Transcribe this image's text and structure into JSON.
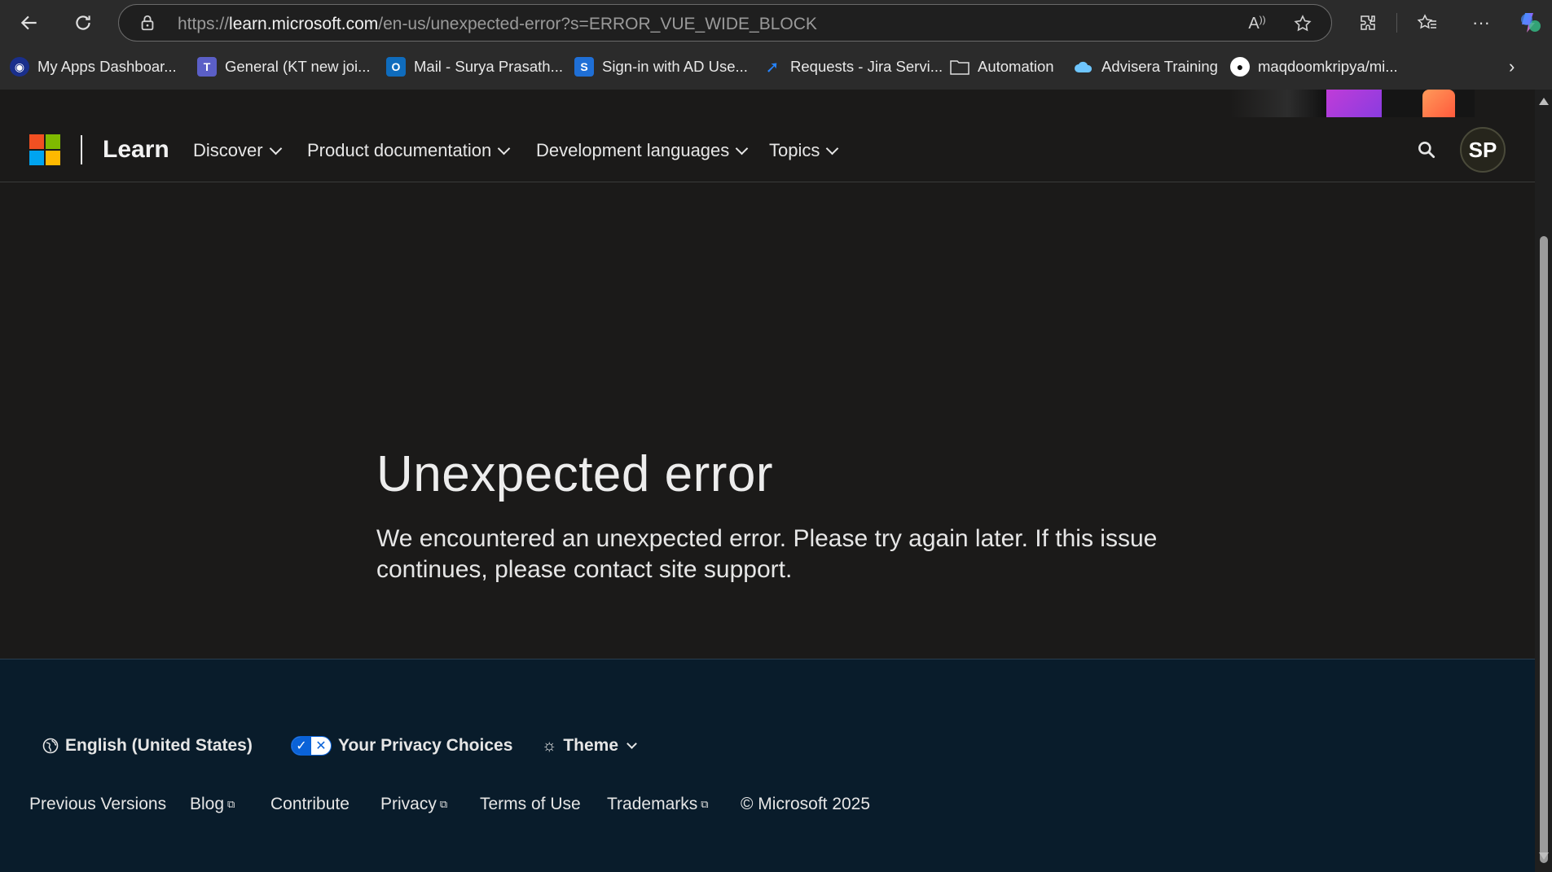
{
  "browser": {
    "url_prefix": "https://",
    "url_host": "learn.microsoft.com",
    "url_path": "/en-us/unexpected-error?s=ERROR_VUE_WIDE_BLOCK",
    "bookmarks": [
      {
        "label": "My Apps Dashboar...",
        "icon": "my-apps-icon"
      },
      {
        "label": "General (KT new joi...",
        "icon": "teams-icon"
      },
      {
        "label": "Mail - Surya Prasath...",
        "icon": "outlook-icon"
      },
      {
        "label": "Sign-in with AD Use...",
        "icon": "s-icon"
      },
      {
        "label": "Requests - Jira Servi...",
        "icon": "jira-icon"
      },
      {
        "label": "Automation",
        "icon": "folder-icon"
      },
      {
        "label": "Advisera Training",
        "icon": "cloud-icon"
      },
      {
        "label": "maqdoomkripya/mi...",
        "icon": "github-icon"
      }
    ]
  },
  "header": {
    "brand": "Learn",
    "nav": [
      "Discover",
      "Product documentation",
      "Development languages",
      "Topics"
    ],
    "avatar_initials": "SP"
  },
  "main": {
    "title": "Unexpected error",
    "message": "We encountered an unexpected error. Please try again later. If this issue continues, please contact site support."
  },
  "footer": {
    "language": "English (United States)",
    "privacy": "Your Privacy Choices",
    "theme": "Theme",
    "links": [
      "Previous Versions",
      "Blog",
      "Contribute",
      "Privacy",
      "Terms of Use",
      "Trademarks"
    ],
    "copyright": "© Microsoft 2025"
  },
  "colors": {
    "page_bg": "#1b1a19",
    "footer_bg": "#091c2b",
    "chrome_bg": "#2b2b2b",
    "ms_red": "#f25022",
    "ms_green": "#7fba00",
    "ms_blue": "#00a4ef",
    "ms_yellow": "#ffb900"
  }
}
